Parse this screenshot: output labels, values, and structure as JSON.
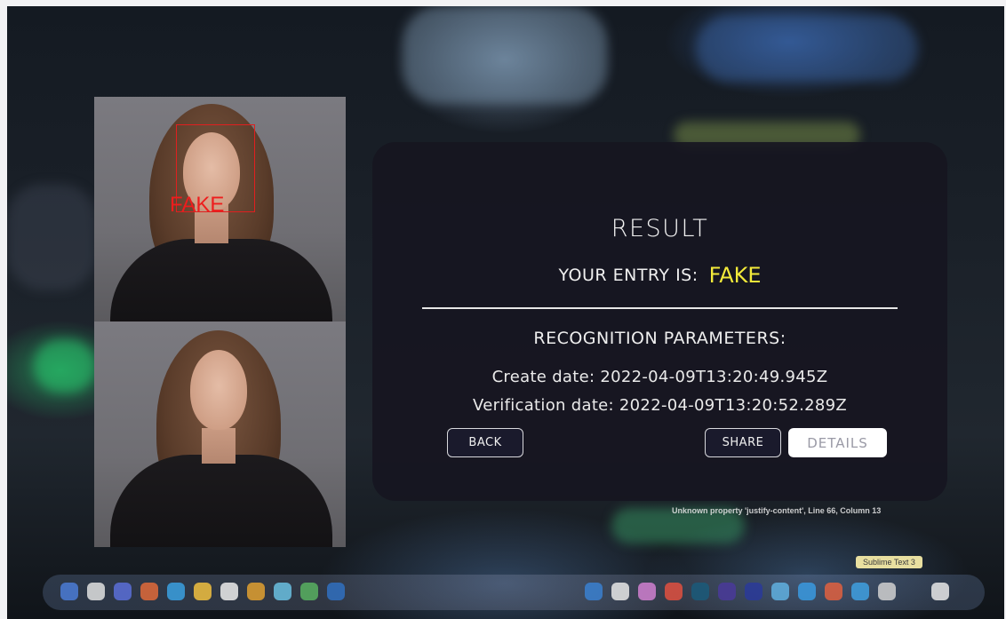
{
  "result": {
    "title": "RESULT",
    "entry_label": "YOUR ENTRY IS:",
    "entry_value": "FAKE",
    "entry_value_color": "#f3ea3a"
  },
  "params": {
    "title": "RECOGNITION PARAMETERS:",
    "create_date": "Create date: 2022-04-09T13:20:49.945Z",
    "verification_date": "Verification date: 2022-04-09T13:20:52.289Z"
  },
  "buttons": {
    "back": "BACK",
    "share": "SHARE",
    "details": "DETAILS"
  },
  "detection": {
    "label": "FAKE",
    "color": "#ee1d1d"
  },
  "background": {
    "status_text": "Unknown property 'justify-content', Line 66, Column 13",
    "sublime_tag": "Sublime Text 3"
  }
}
